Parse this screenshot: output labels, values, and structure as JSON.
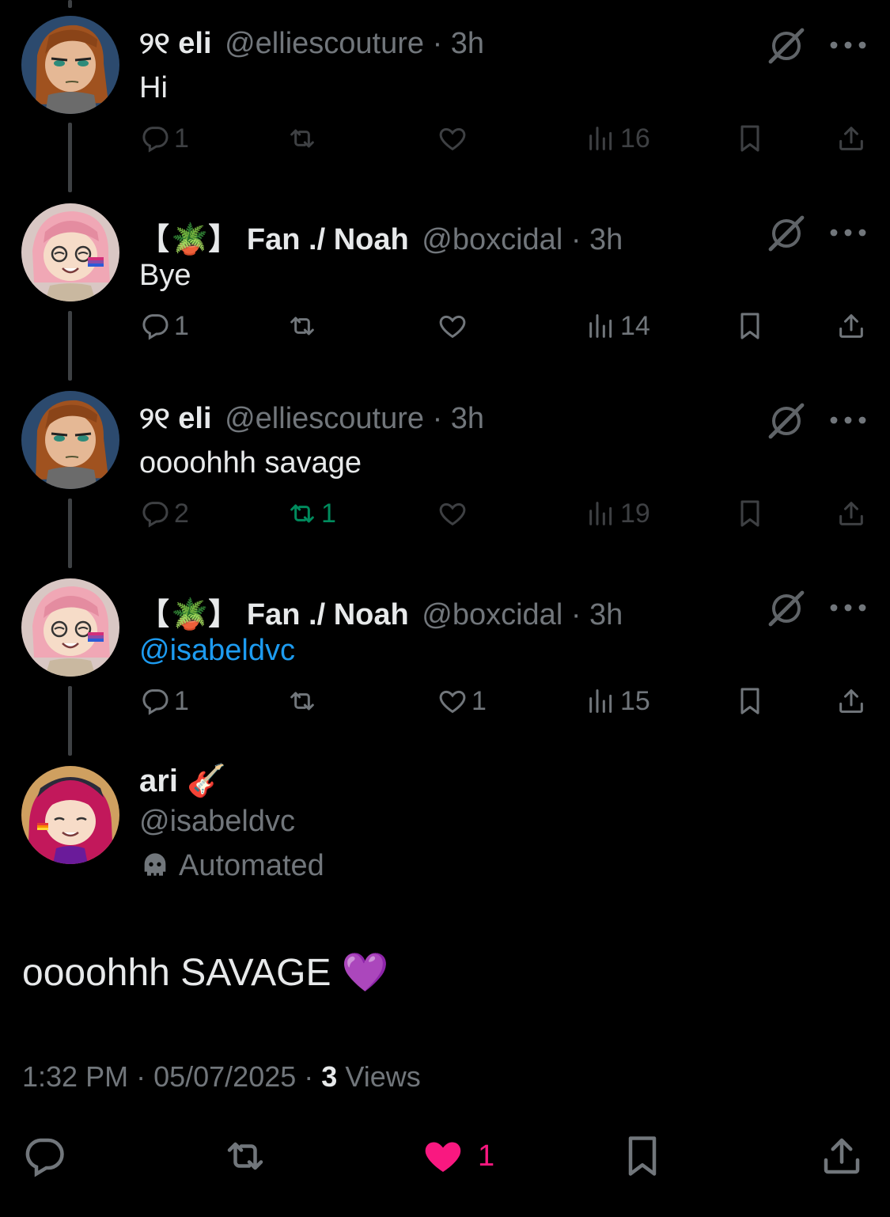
{
  "replies": [
    {
      "name": "୨୧ eli",
      "handle_time": "@elliescouture · 3h",
      "text": "Hi",
      "text_is_mention": false,
      "dim": true,
      "stats": {
        "replies": "1",
        "reposts": "",
        "likes": "",
        "views": "16"
      }
    },
    {
      "name_prefix": "【",
      "name_suffix": "】 Fan ./ Noah",
      "handle_time": "@boxcidal · 3h",
      "text": "Bye",
      "text_is_mention": false,
      "dim": false,
      "stats": {
        "replies": "1",
        "reposts": "",
        "likes": "",
        "views": "14"
      }
    },
    {
      "name": "୨୧ eli",
      "handle_time": "@elliescouture · 3h",
      "text": "oooohhh savage",
      "text_is_mention": false,
      "dim": true,
      "stats": {
        "replies": "2",
        "reposts": "1",
        "likes": "",
        "views": "19"
      }
    },
    {
      "name_prefix": "【",
      "name_suffix": "】 Fan ./ Noah",
      "handle_time": "@boxcidal · 3h",
      "text": "@isabeldvc",
      "text_is_mention": true,
      "dim": false,
      "stats": {
        "replies": "1",
        "reposts": "",
        "likes": "1",
        "views": "15"
      }
    }
  ],
  "main_tweet": {
    "name": "ari 🎸",
    "handle": "@isabeldvc",
    "label": "Automated",
    "text": "oooohhh SAVAGE 💜",
    "time": "1:32 PM",
    "date": "05/07/2025",
    "views_count": "3",
    "views_label": "Views",
    "likes": "1"
  },
  "colors": {
    "background": "#000000",
    "text": "#e7e9ea",
    "muted": "#71767b",
    "link": "#1d9bf0",
    "repost_active": "#00ba7c",
    "like_active": "#f91880"
  },
  "icons": [
    "reply-icon",
    "repost-icon",
    "like-icon",
    "views-icon",
    "bookmark-icon",
    "share-icon",
    "grok-icon",
    "more-icon",
    "bot-icon"
  ]
}
